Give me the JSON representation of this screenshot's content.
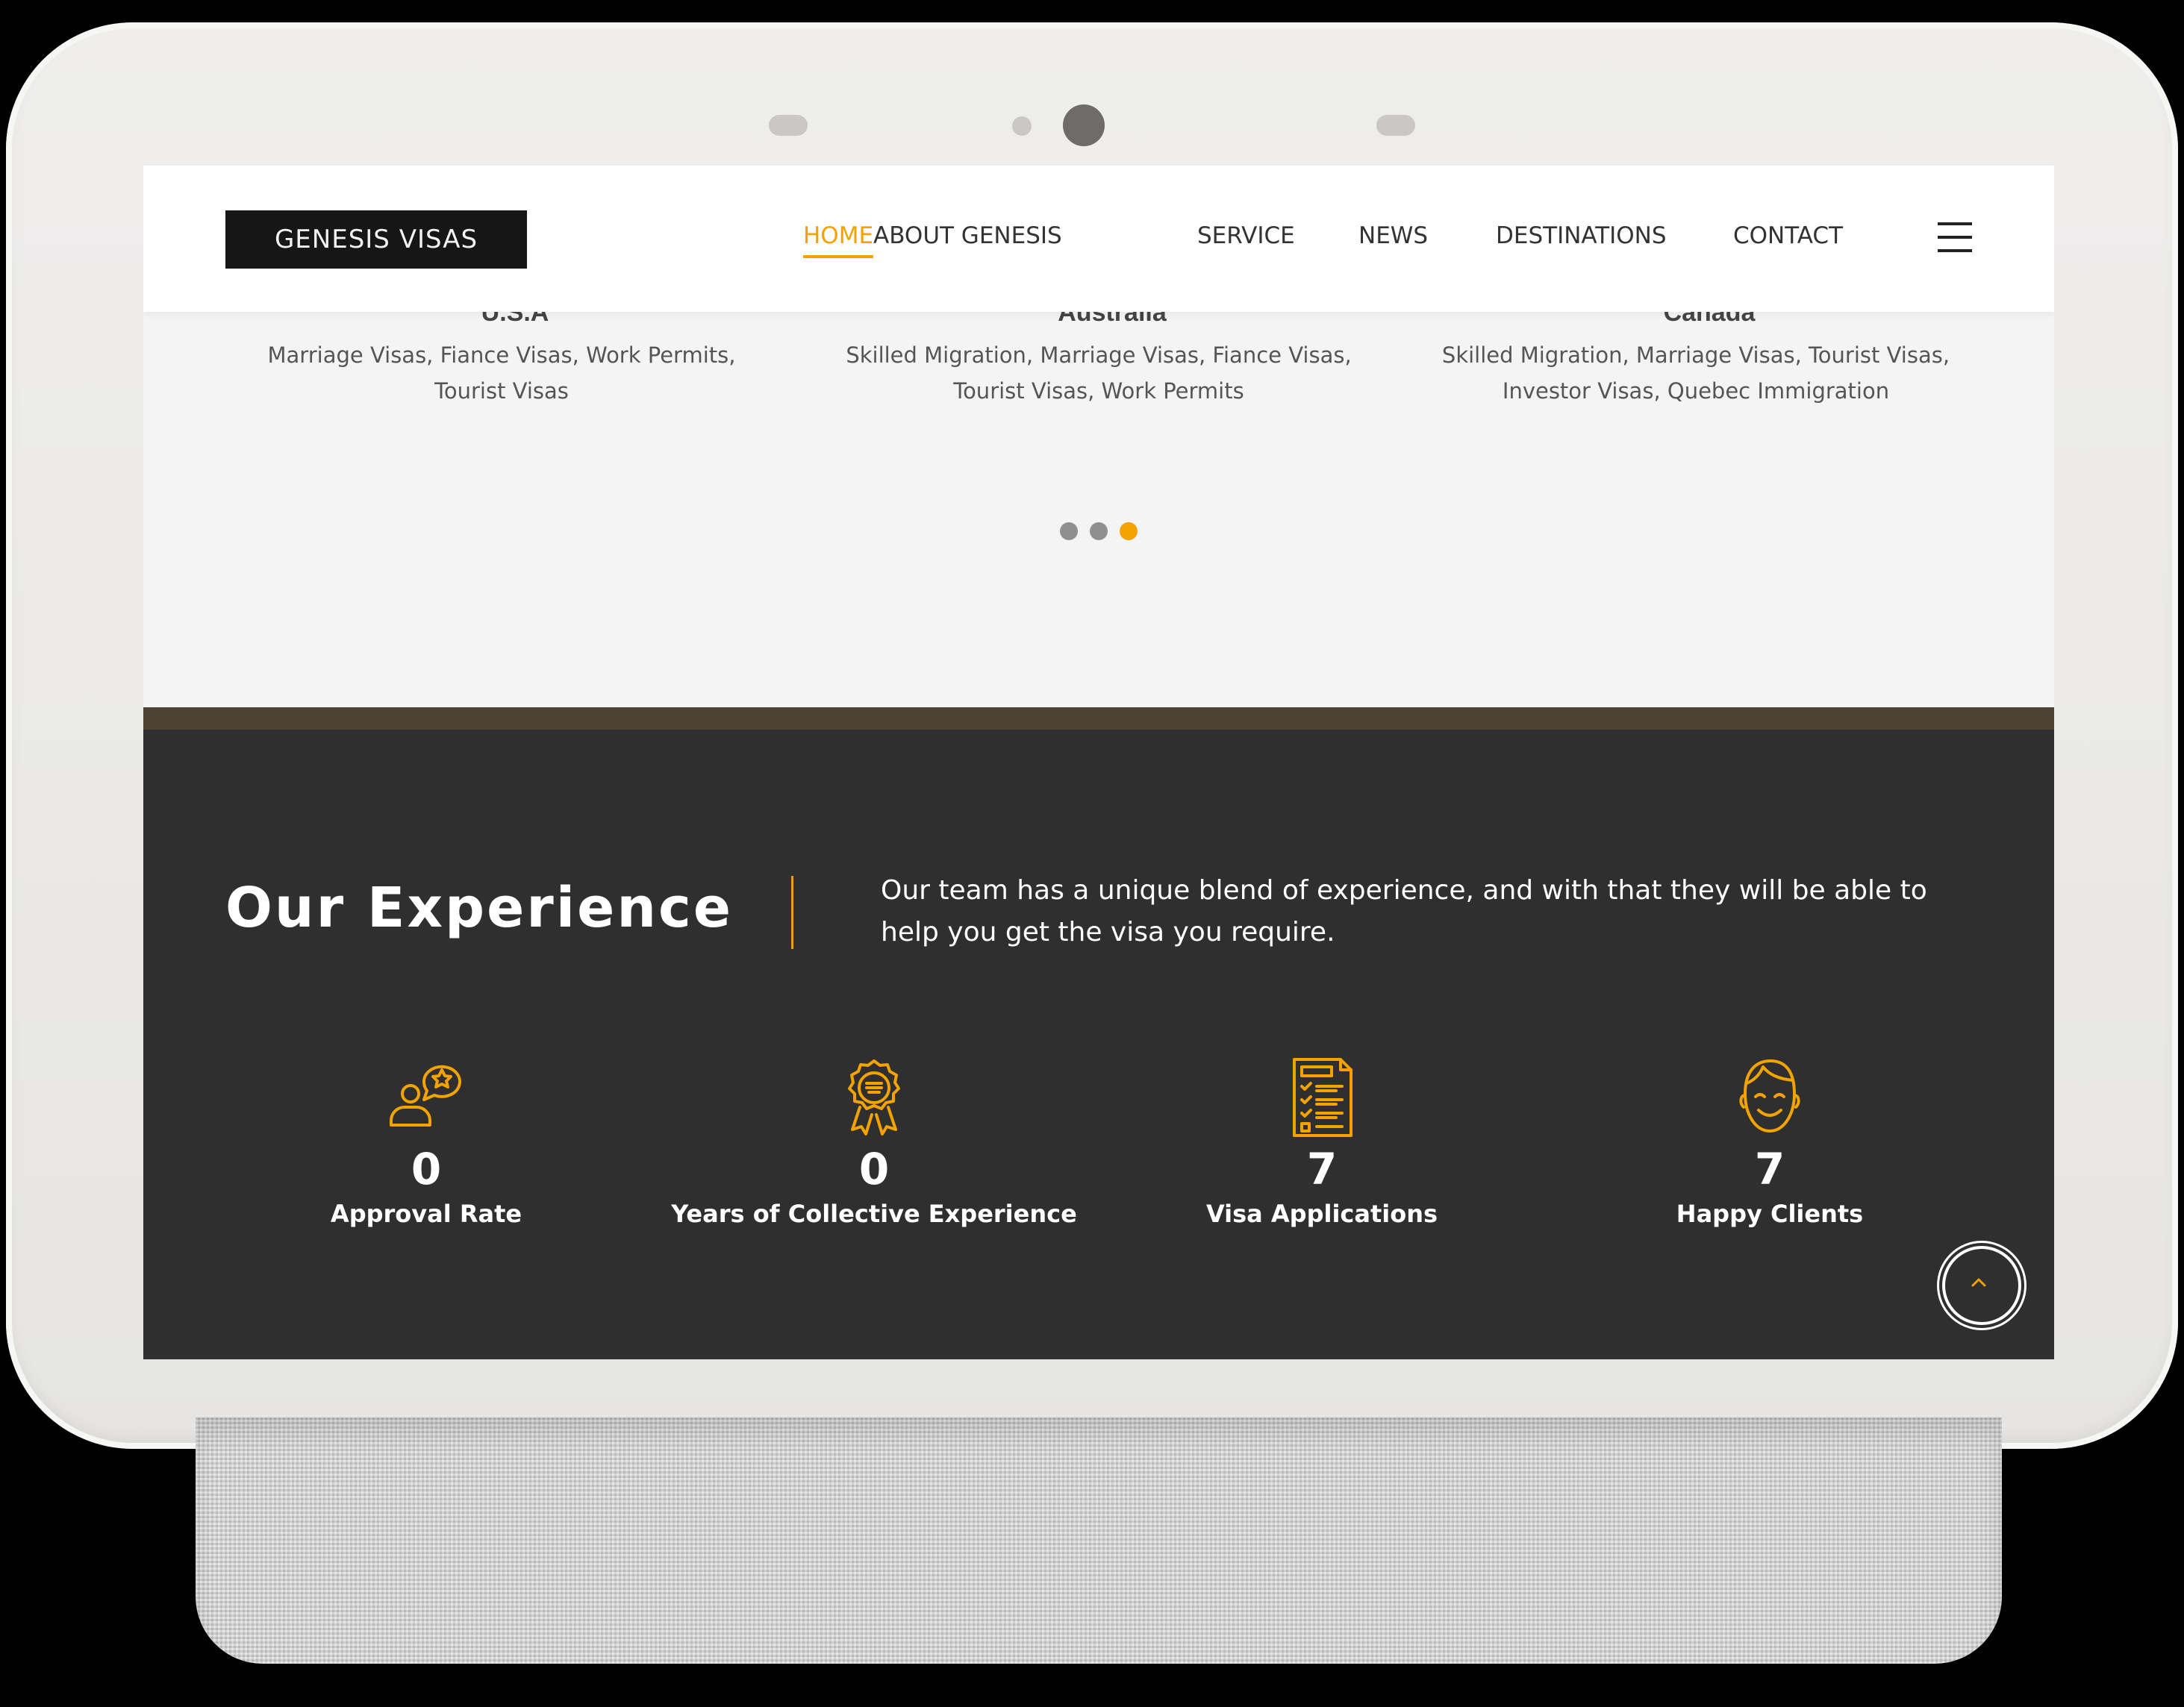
{
  "site": {
    "logo_text": "GENESIS VISAS"
  },
  "nav": {
    "items": [
      {
        "label": "HOME",
        "active": true
      },
      {
        "label": "ABOUT GENESIS",
        "active": false
      },
      {
        "label": "SERVICE",
        "active": false
      },
      {
        "label": "NEWS",
        "active": false
      },
      {
        "label": "DESTINATIONS",
        "active": false
      },
      {
        "label": "CONTACT",
        "active": false
      }
    ],
    "menu_icon": "hamburger-menu-icon"
  },
  "destinations": [
    {
      "title": "U.S.A",
      "description": "Marriage Visas, Fiance Visas, Work Permits, Tourist Visas"
    },
    {
      "title": "Australia",
      "description": "Skilled Migration, Marriage Visas, Fiance Visas, Tourist Visas, Work Permits"
    },
    {
      "title": "Canada",
      "description": "Skilled Migration, Marriage Visas, Tourist Visas, Investor Visas, Quebec Immigration"
    }
  ],
  "carousel": {
    "dot_count": 3,
    "active_index": 2
  },
  "experience": {
    "title": "Our Experience",
    "text": "Our team has a unique blend of experience, and with that they will be able to help you get the visa you require.",
    "stats": [
      {
        "icon": "person-speech-star-icon",
        "value": "0",
        "label": "Approval Rate"
      },
      {
        "icon": "award-ribbon-icon",
        "value": "0",
        "label": "Years of Collective Experience"
      },
      {
        "icon": "checklist-document-icon",
        "value": "7",
        "label": "Visa Applications"
      },
      {
        "icon": "smiling-face-icon",
        "value": "7",
        "label": "Happy Clients"
      }
    ]
  },
  "colors": {
    "accent": "#f2a300",
    "dark_section": "#2f2f2f",
    "brown_band": "#4d4234",
    "header_bg": "#ffffff",
    "logo_bg": "#161616"
  },
  "scroll_top_icon": "chevron-up-icon"
}
